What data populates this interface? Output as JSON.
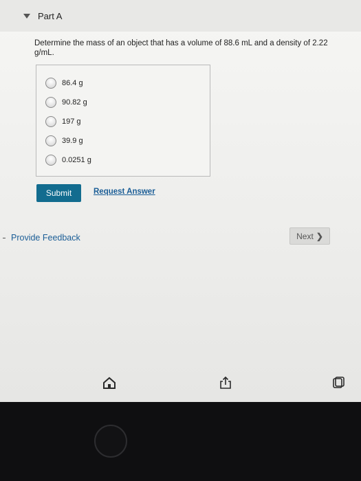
{
  "part": {
    "title": "Part A"
  },
  "question": {
    "text": "Determine the mass of an object that has a volume of 88.6 mL and a density of 2.22 g/mL."
  },
  "options": [
    {
      "label": "86.4 g"
    },
    {
      "label": "90.82 g"
    },
    {
      "label": "197 g"
    },
    {
      "label": "39.9 g"
    },
    {
      "label": "0.0251 g"
    }
  ],
  "actions": {
    "submit_label": "Submit",
    "request_answer_label": "Request Answer"
  },
  "footer": {
    "feedback_label": "Provide Feedback",
    "next_label": "Next"
  },
  "toolbar": {
    "icons": [
      "home-icon",
      "share-icon",
      "tabs-icon"
    ]
  },
  "colors": {
    "submit_bg": "#126c8f",
    "link": "#1a5d96"
  }
}
